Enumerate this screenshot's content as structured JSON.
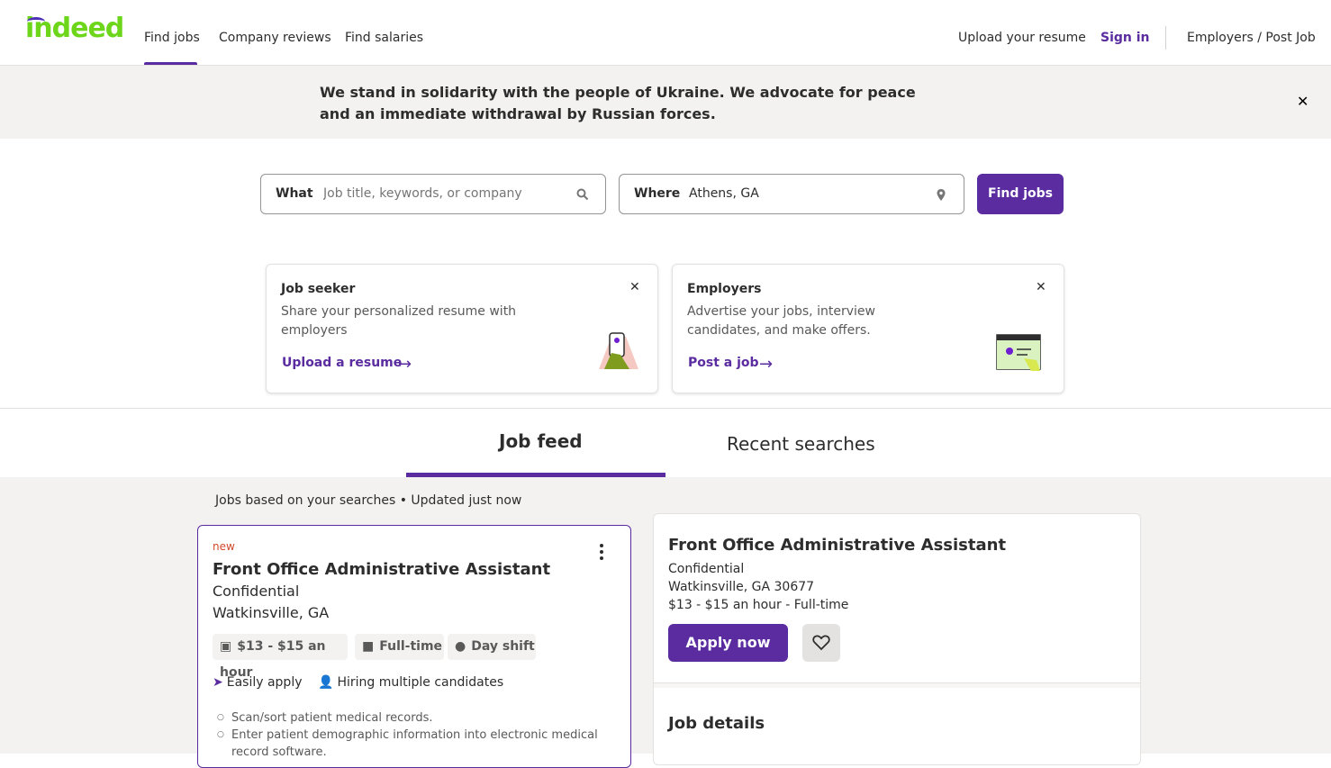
{
  "header": {
    "logo_text": "indeed",
    "nav": [
      "Find jobs",
      "Company reviews",
      "Find salaries"
    ],
    "upload_resume": "Upload your resume",
    "sign_in": "Sign in",
    "employers": "Employers / Post Job"
  },
  "banner": {
    "text": "We stand in solidarity with the people of Ukraine. We advocate for peace and an immediate withdrawal by Russian forces.",
    "close_icon": "close-icon"
  },
  "search": {
    "what_label": "What",
    "what_placeholder": "Job title, keywords, or company",
    "where_label": "Where",
    "where_value": "Athens, GA",
    "button": "Find jobs"
  },
  "promo": {
    "seeker": {
      "title": "Job seeker",
      "desc": "Share your personalized resume with employers",
      "link": "Upload a resume"
    },
    "employer": {
      "title": "Employers",
      "desc": "Advertise your jobs, interview candidates, and make offers.",
      "link": "Post a job"
    }
  },
  "tabs": [
    "Job feed",
    "Recent searches"
  ],
  "feed": {
    "note": "Jobs based on your searches • Updated just now"
  },
  "job_card": {
    "badge": "new",
    "title": "Front Office Administrative Assistant",
    "company": "Confidential",
    "location": "Watkinsville, GA",
    "chips": [
      "$13 - $15 an hour",
      "Full-time",
      "Day shift"
    ],
    "easily_apply": "Easily apply",
    "hiring": "Hiring multiple candidates",
    "bullets": [
      "Scan/sort patient medical records.",
      "Enter patient demographic information into electronic medical record software."
    ]
  },
  "detail": {
    "title": "Front Office Administrative Assistant",
    "company": "Confidential",
    "location": "Watkinsville, GA 30677",
    "pay": "$13 - $15 an hour  - Full-time",
    "apply": "Apply now",
    "section": "Job details"
  },
  "colors": {
    "brand_purple": "#5a2ca0",
    "logo_green": "#6dd61b",
    "new_badge": "#d2482c"
  }
}
